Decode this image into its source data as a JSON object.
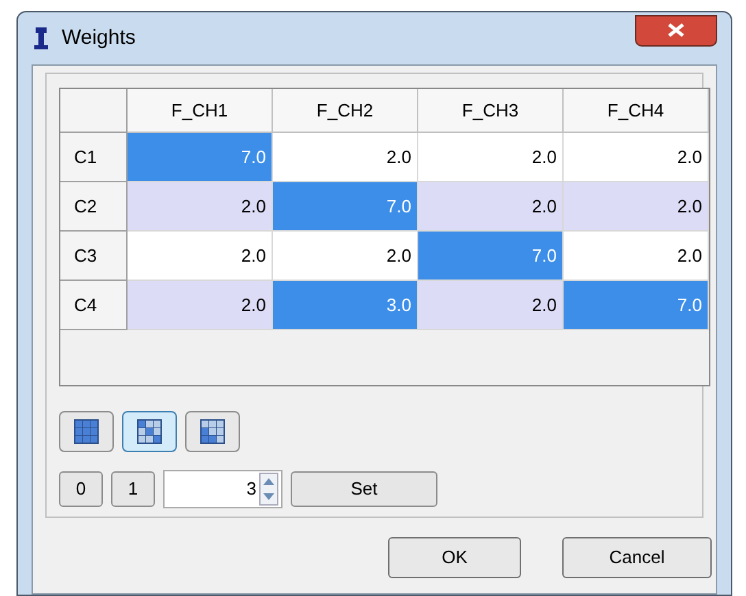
{
  "window": {
    "title": "Weights"
  },
  "table": {
    "columns": [
      "F_CH1",
      "F_CH2",
      "F_CH3",
      "F_CH4"
    ],
    "rows": [
      {
        "header": "C1",
        "cells": [
          {
            "value": "7.0",
            "selected": true
          },
          {
            "value": "2.0",
            "selected": false
          },
          {
            "value": "2.0",
            "selected": false
          },
          {
            "value": "2.0",
            "selected": false
          }
        ]
      },
      {
        "header": "C2",
        "cells": [
          {
            "value": "2.0",
            "selected": false
          },
          {
            "value": "7.0",
            "selected": true
          },
          {
            "value": "2.0",
            "selected": false
          },
          {
            "value": "2.0",
            "selected": false
          }
        ]
      },
      {
        "header": "C3",
        "cells": [
          {
            "value": "2.0",
            "selected": false
          },
          {
            "value": "2.0",
            "selected": false
          },
          {
            "value": "7.0",
            "selected": true
          },
          {
            "value": "2.0",
            "selected": false
          }
        ]
      },
      {
        "header": "C4",
        "cells": [
          {
            "value": "2.0",
            "selected": false
          },
          {
            "value": "3.0",
            "selected": true
          },
          {
            "value": "2.0",
            "selected": false
          },
          {
            "value": "7.0",
            "selected": true
          }
        ]
      }
    ]
  },
  "mode_buttons": [
    {
      "kind": "all",
      "selected": false
    },
    {
      "kind": "diagonal",
      "selected": true
    },
    {
      "kind": "lower",
      "selected": false
    }
  ],
  "value_buttons": [
    "0",
    "1"
  ],
  "spinner": {
    "value": "3"
  },
  "set_button": "Set",
  "buttons": [
    "OK",
    "Cancel"
  ]
}
